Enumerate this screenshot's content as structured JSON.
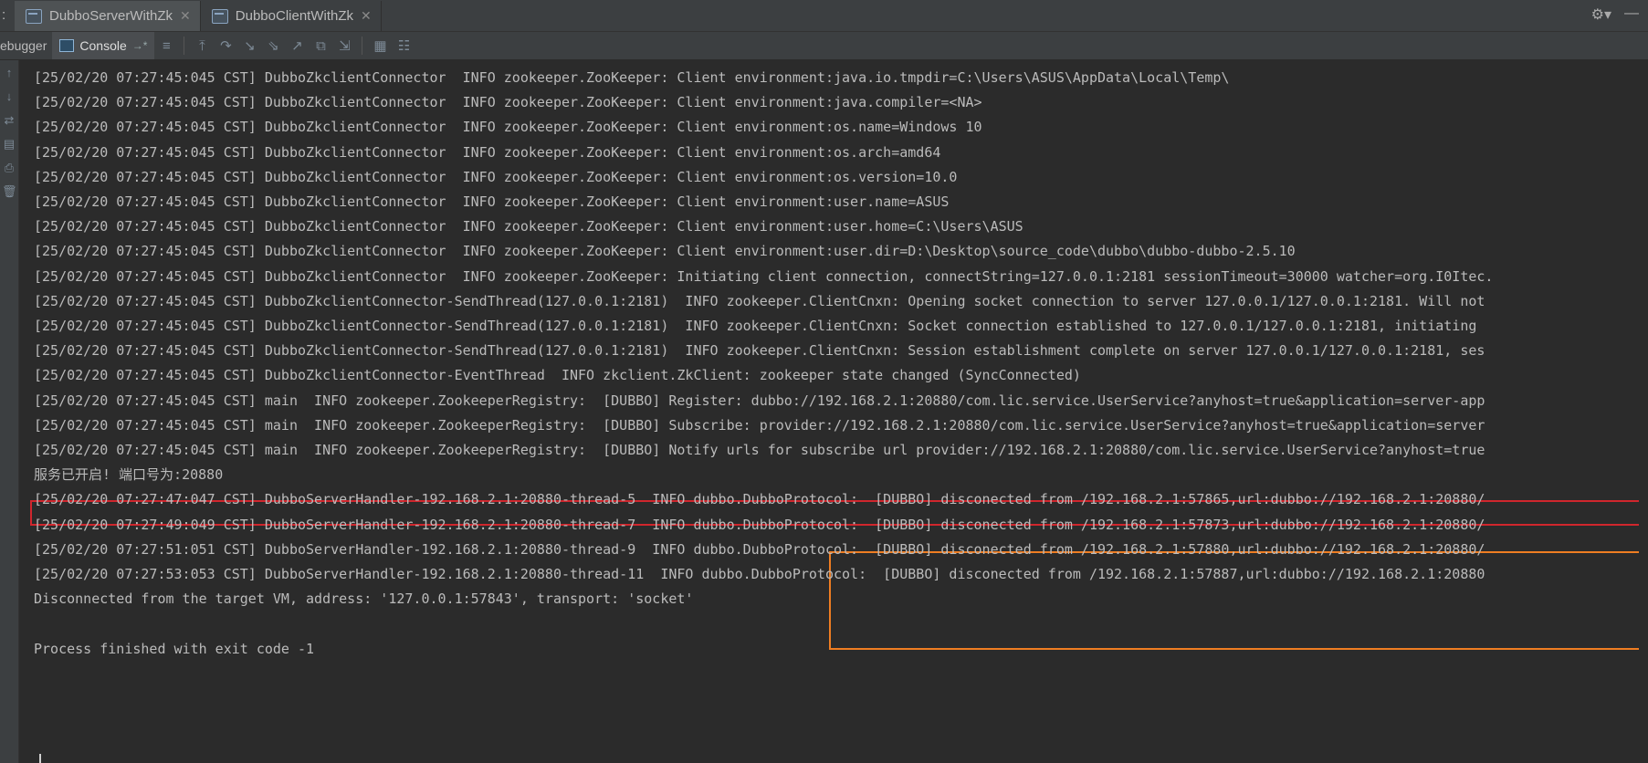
{
  "tabs": [
    {
      "label": "DubboServerWithZk",
      "active": true
    },
    {
      "label": "DubboClientWithZk",
      "active": false
    }
  ],
  "toolbar": {
    "debugger_label": "ebugger",
    "console_label": "Console",
    "pin_glyph": "→*"
  },
  "console": {
    "lines": [
      {
        "text": "[25/02/20 07:27:45:045 CST] DubboZkclientConnector  INFO zookeeper.ZooKeeper: Client environment:java.io.tmpdir=C:\\Users\\ASUS\\AppData\\Local\\Temp\\"
      },
      {
        "text": "[25/02/20 07:27:45:045 CST] DubboZkclientConnector  INFO zookeeper.ZooKeeper: Client environment:java.compiler=<NA>"
      },
      {
        "text": "[25/02/20 07:27:45:045 CST] DubboZkclientConnector  INFO zookeeper.ZooKeeper: Client environment:os.name=Windows 10"
      },
      {
        "text": "[25/02/20 07:27:45:045 CST] DubboZkclientConnector  INFO zookeeper.ZooKeeper: Client environment:os.arch=amd64"
      },
      {
        "text": "[25/02/20 07:27:45:045 CST] DubboZkclientConnector  INFO zookeeper.ZooKeeper: Client environment:os.version=10.0"
      },
      {
        "text": "[25/02/20 07:27:45:045 CST] DubboZkclientConnector  INFO zookeeper.ZooKeeper: Client environment:user.name=ASUS"
      },
      {
        "text": "[25/02/20 07:27:45:045 CST] DubboZkclientConnector  INFO zookeeper.ZooKeeper: Client environment:user.home=C:\\Users\\ASUS"
      },
      {
        "text": "[25/02/20 07:27:45:045 CST] DubboZkclientConnector  INFO zookeeper.ZooKeeper: Client environment:user.dir=D:\\Desktop\\source_code\\dubbo\\dubbo-dubbo-2.5.10"
      },
      {
        "text": "[25/02/20 07:27:45:045 CST] DubboZkclientConnector  INFO zookeeper.ZooKeeper: Initiating client connection, connectString=127.0.0.1:2181 sessionTimeout=30000 watcher=org.I0Itec."
      },
      {
        "text": "[25/02/20 07:27:45:045 CST] DubboZkclientConnector-SendThread(127.0.0.1:2181)  INFO zookeeper.ClientCnxn: Opening socket connection to server 127.0.0.1/127.0.0.1:2181. Will not"
      },
      {
        "text": "[25/02/20 07:27:45:045 CST] DubboZkclientConnector-SendThread(127.0.0.1:2181)  INFO zookeeper.ClientCnxn: Socket connection established to 127.0.0.1/127.0.0.1:2181, initiating"
      },
      {
        "text": "[25/02/20 07:27:45:045 CST] DubboZkclientConnector-SendThread(127.0.0.1:2181)  INFO zookeeper.ClientCnxn: Session establishment complete on server 127.0.0.1/127.0.0.1:2181, ses"
      },
      {
        "text": "[25/02/20 07:27:45:045 CST] DubboZkclientConnector-EventThread  INFO zkclient.ZkClient: zookeeper state changed (SyncConnected)"
      },
      {
        "text": "[25/02/20 07:27:45:045 CST] main  INFO zookeeper.ZookeeperRegistry:  [DUBBO] Register: dubbo://192.168.2.1:20880/com.lic.service.UserService?anyhost=true&application=server-app"
      },
      {
        "text": "[25/02/20 07:27:45:045 CST] main  INFO zookeeper.ZookeeperRegistry:  [DUBBO] Subscribe: provider://192.168.2.1:20880/com.lic.service.UserService?anyhost=true&application=server"
      },
      {
        "text": "[25/02/20 07:27:45:045 CST] main  INFO zookeeper.ZookeeperRegistry:  [DUBBO] Notify urls for subscribe url provider://192.168.2.1:20880/com.lic.service.UserService?anyhost=true"
      },
      {
        "text": "服务已开启! 端口号为:20880"
      },
      {
        "text": "[25/02/20 07:27:47:047 CST] DubboServerHandler-192.168.2.1:20880-thread-5  INFO dubbo.DubboProtocol:  [DUBBO] disconected from /192.168.2.1:57865,url:dubbo://192.168.2.1:20880/"
      },
      {
        "text": "[25/02/20 07:27:49:049 CST] DubboServerHandler-192.168.2.1:20880-thread-7  INFO dubbo.DubboProtocol:  [DUBBO] disconected from /192.168.2.1:57873,url:dubbo://192.168.2.1:20880/"
      },
      {
        "text": "[25/02/20 07:27:51:051 CST] DubboServerHandler-192.168.2.1:20880-thread-9  INFO dubbo.DubboProtocol:  [DUBBO] disconected from /192.168.2.1:57880,url:dubbo://192.168.2.1:20880/"
      },
      {
        "text": "[25/02/20 07:27:53:053 CST] DubboServerHandler-192.168.2.1:20880-thread-11  INFO dubbo.DubboProtocol:  [DUBBO] disconected from /192.168.2.1:57887,url:dubbo://192.168.2.1:20880"
      },
      {
        "text": "Disconnected from the target VM, address: '127.0.0.1:57843', transport: 'socket'"
      },
      {
        "text": ""
      },
      {
        "text": "Process finished with exit code -1"
      }
    ]
  },
  "colors": {
    "background": "#2b2b2b",
    "panel": "#3c3f41",
    "highlight_red": "#d0262d",
    "highlight_orange": "#ef7d22"
  },
  "icons": [
    "settings-gear-icon",
    "minimize-icon",
    "console-icon",
    "up-arrow-icon",
    "down-arrow-icon",
    "trash-icon"
  ]
}
